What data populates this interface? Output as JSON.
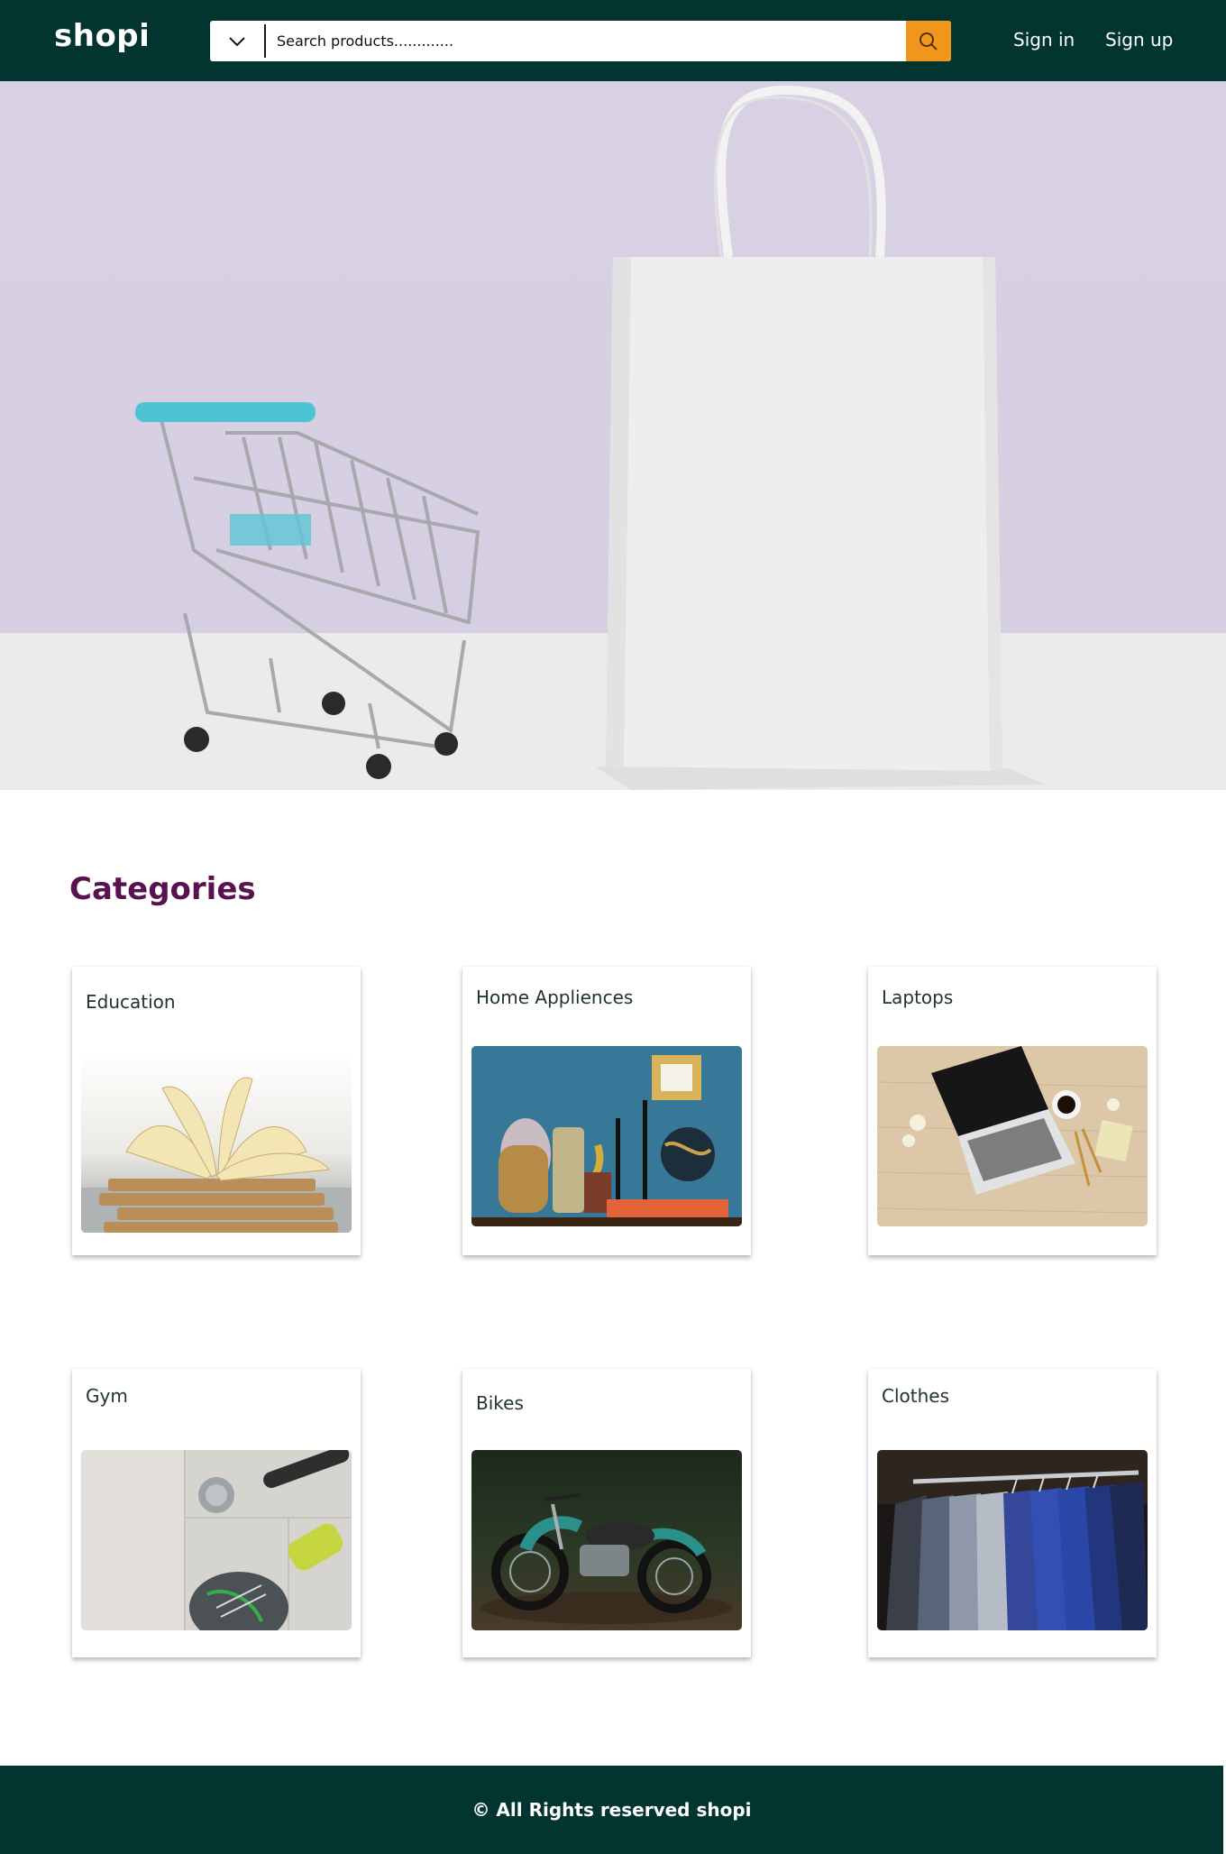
{
  "header": {
    "logo": "shopi",
    "search": {
      "placeholder": "Search products............."
    },
    "sign_in": "Sign in",
    "sign_up": "Sign up"
  },
  "categories": {
    "title": "Categories",
    "items": [
      {
        "label": "Education"
      },
      {
        "label": "Home Appliences"
      },
      {
        "label": "Laptops"
      },
      {
        "label": "Gym"
      },
      {
        "label": "Bikes"
      },
      {
        "label": "Clothes"
      }
    ]
  },
  "footer": {
    "text": "© All Rights reserved shopi"
  },
  "colors": {
    "navbar": "#023430",
    "accent": "#f0961b",
    "heading": "#5a1150"
  },
  "icons": {
    "dropdown": "chevron-down-icon",
    "search": "search-icon"
  }
}
